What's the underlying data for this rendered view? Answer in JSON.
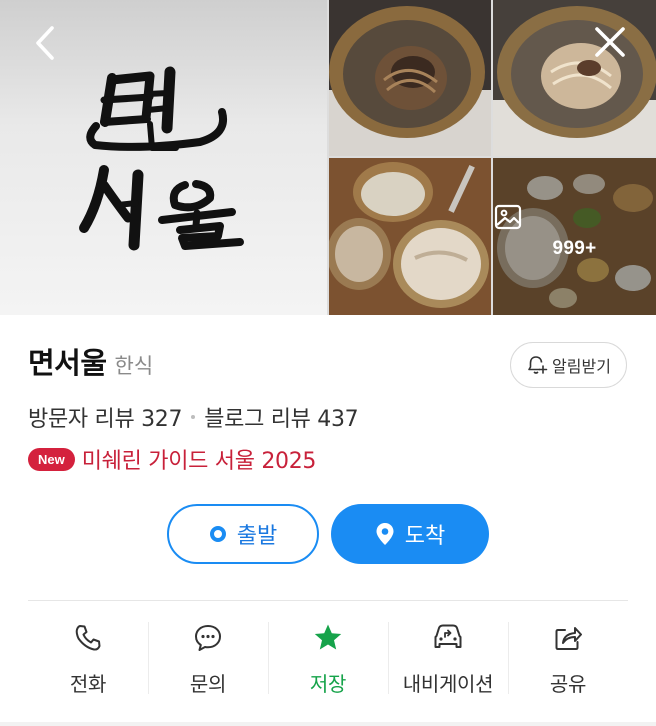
{
  "gallery": {
    "more_count": "999+"
  },
  "place": {
    "name": "면서울",
    "category": "한식"
  },
  "alarm_button": {
    "label": "알림받기"
  },
  "reviews": {
    "visitor": "방문자 리뷰 327",
    "blog": "블로그 리뷰 437"
  },
  "michelin": {
    "badge": "New",
    "text": "미쉐린 가이드 서울 2025"
  },
  "route": {
    "depart_label": "출발",
    "arrive_label": "도착"
  },
  "actions": [
    {
      "label": "전화",
      "icon": "phone-icon"
    },
    {
      "label": "문의",
      "icon": "chat-icon"
    },
    {
      "label": "저장",
      "icon": "star-icon"
    },
    {
      "label": "내비게이션",
      "icon": "car-navigation-icon"
    },
    {
      "label": "공유",
      "icon": "share-icon"
    }
  ],
  "colors": {
    "primary_blue": "#1a8cf3",
    "michelin_red": "#c8213a",
    "saved_green": "#16a34a"
  }
}
